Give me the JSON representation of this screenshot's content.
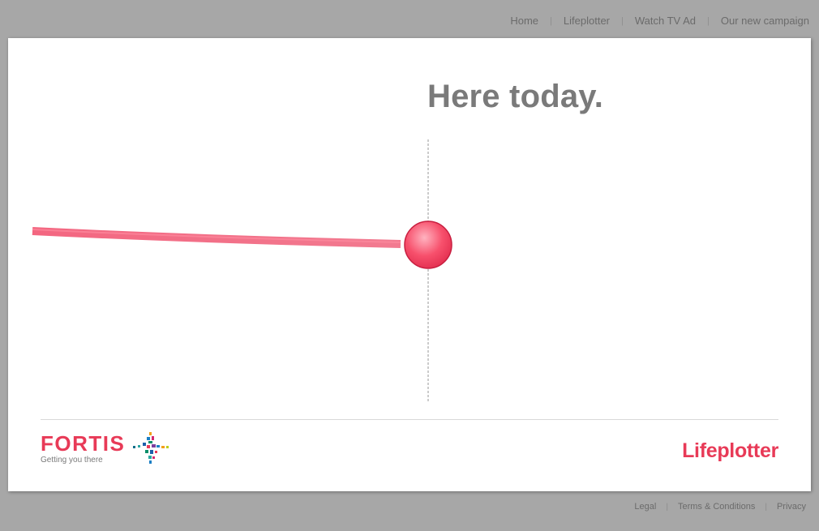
{
  "top_nav": {
    "items": [
      {
        "label": "Home"
      },
      {
        "label": "Lifeplotter"
      },
      {
        "label": "Watch TV Ad"
      },
      {
        "label": "Our new campaign"
      }
    ],
    "separator": "|"
  },
  "main": {
    "headline": "Here today."
  },
  "brand": {
    "name": "FORTIS",
    "tagline": "Getting you there"
  },
  "app_logo": {
    "name": "Lifeplotter"
  },
  "footer_nav": {
    "items": [
      {
        "label": "Legal"
      },
      {
        "label": "Terms & Conditions"
      },
      {
        "label": "Privacy"
      }
    ],
    "separator": "|"
  },
  "colors": {
    "background": "#a7a7a7",
    "panel": "#ffffff",
    "accent": "#e83a57",
    "headline": "#7a7a7a",
    "nav_text": "#6b6b6b"
  }
}
